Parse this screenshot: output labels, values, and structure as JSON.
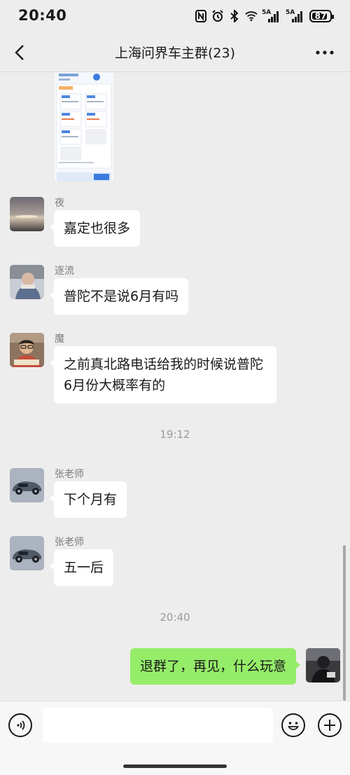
{
  "status_bar": {
    "time": "20:40",
    "network_1": "5A",
    "network_2": "5A",
    "battery": "87",
    "icons": [
      "nfc-icon",
      "alarm-icon",
      "bluetooth-icon",
      "wifi-icon",
      "signal-icon",
      "signal-icon",
      "battery-icon"
    ]
  },
  "header": {
    "title": "上海问界车主群(23)",
    "back_icon": "chevron-left-icon",
    "more_icon": "more-dots-icon"
  },
  "messages": [
    {
      "sender": "夜",
      "text": "嘉定也很多"
    },
    {
      "sender": "逐流",
      "text": "普陀不是说6月有吗"
    },
    {
      "sender": "魔",
      "text": "之前真北路电话给我的时候说普陀6月份大概率有的"
    },
    {
      "sender": "张老师",
      "text": "下个月有"
    },
    {
      "sender": "张老师",
      "text": "五一后"
    },
    {
      "sender": "",
      "text": "退群了，再见，什么玩意",
      "is_self": true
    }
  ],
  "timestamps": [
    "19:12",
    "20:40"
  ],
  "input_bar": {
    "voice_icon": "voice-icon",
    "emoji_icon": "emoji-icon",
    "plus_icon": "plus-icon"
  },
  "colors": {
    "background": "#ededed",
    "incoming_bubble": "#ffffff",
    "outgoing_bubble": "#95ec69",
    "sender_name": "#7c7c7c",
    "timestamp": "#9b9b9b"
  }
}
